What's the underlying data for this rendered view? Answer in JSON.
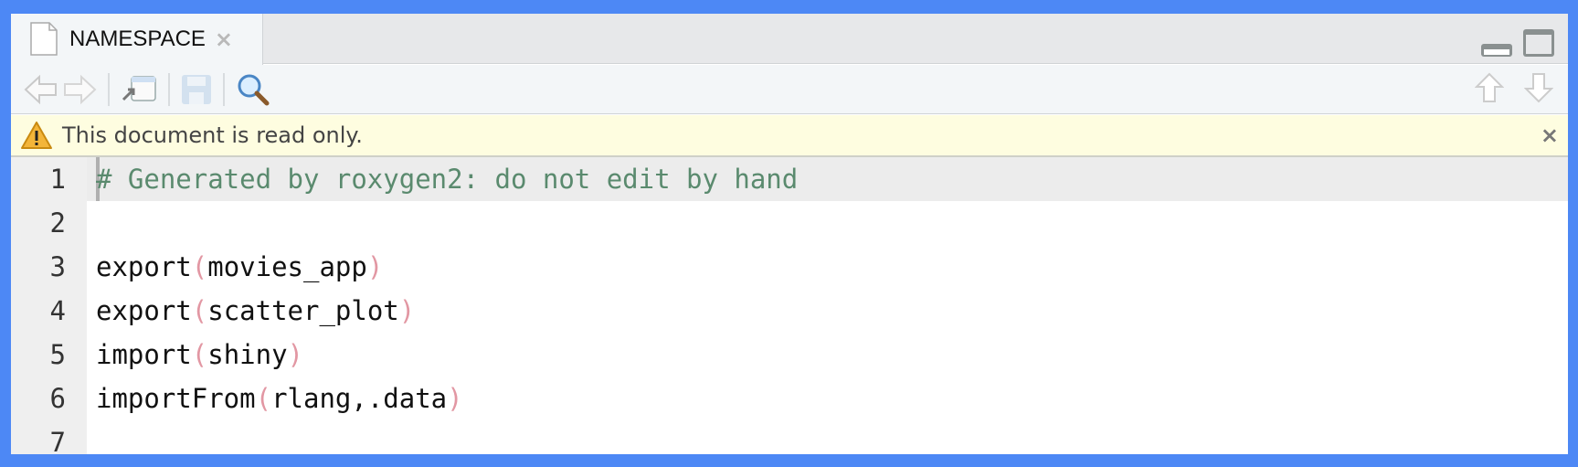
{
  "tab": {
    "title": "NAMESPACE",
    "close": "×"
  },
  "infobar": {
    "message": "This document is read only.",
    "close": "×"
  },
  "editor": {
    "lines": [
      {
        "n": "1",
        "parts": [
          {
            "t": "# Generated by roxygen2: do not edit by hand",
            "c": "cm"
          }
        ]
      },
      {
        "n": "2",
        "parts": []
      },
      {
        "n": "3",
        "parts": [
          {
            "t": "export"
          },
          {
            "t": "(",
            "c": "p"
          },
          {
            "t": "movies_app"
          },
          {
            "t": ")",
            "c": "p"
          }
        ]
      },
      {
        "n": "4",
        "parts": [
          {
            "t": "export"
          },
          {
            "t": "(",
            "c": "p"
          },
          {
            "t": "scatter_plot"
          },
          {
            "t": ")",
            "c": "p"
          }
        ]
      },
      {
        "n": "5",
        "parts": [
          {
            "t": "import"
          },
          {
            "t": "(",
            "c": "p"
          },
          {
            "t": "shiny"
          },
          {
            "t": ")",
            "c": "p"
          }
        ]
      },
      {
        "n": "6",
        "parts": [
          {
            "t": "importFrom"
          },
          {
            "t": "(",
            "c": "p"
          },
          {
            "t": "rlang,.data"
          },
          {
            "t": ")",
            "c": "p"
          }
        ]
      },
      {
        "n": "7",
        "parts": []
      }
    ]
  },
  "colors": {
    "border": "#4d88f5",
    "comment": "#5a8a6e",
    "paren": "#e297a3",
    "infobar": "#fefde0"
  }
}
